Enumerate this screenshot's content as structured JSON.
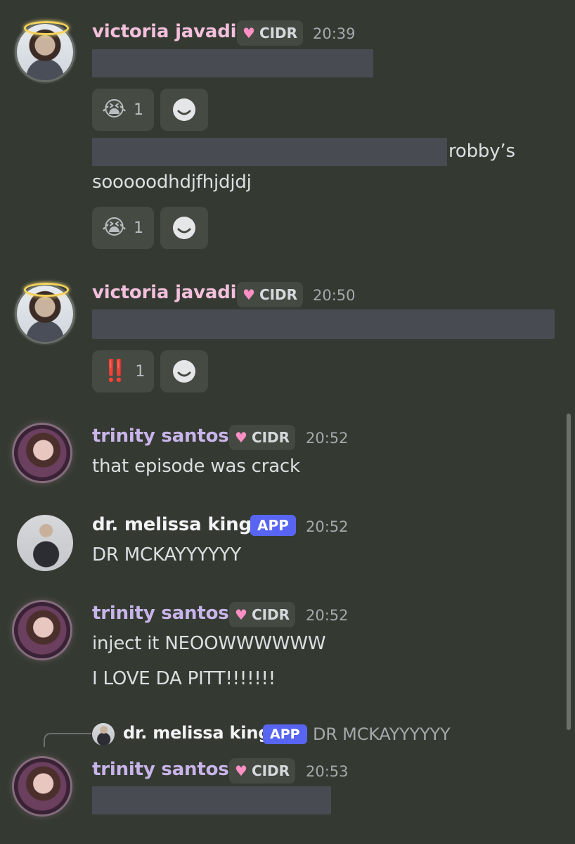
{
  "messages": {
    "g1": {
      "author": "victoria javadi",
      "tag": "CIDR",
      "time": "20:39",
      "reaction1": {
        "emoji": "😭",
        "count": "1"
      },
      "text_after_redact": "robby’s",
      "text_line2": "sooooodhdjfhjdjdj",
      "reaction2": {
        "emoji": "😭",
        "count": "1"
      }
    },
    "g2": {
      "author": "victoria javadi",
      "tag": "CIDR",
      "time": "20:50",
      "reaction": {
        "emoji": "‼️",
        "count": "1"
      }
    },
    "g3": {
      "author": "trinity santos",
      "tag": "CIDR",
      "time": "20:52",
      "text": "that episode was crack"
    },
    "g4": {
      "author": "dr. melissa king",
      "badge": "APP",
      "time": "20:52",
      "text": "DR MCKAYYYYYY"
    },
    "g5": {
      "author": "trinity santos",
      "tag": "CIDR",
      "time": "20:52",
      "line1": "inject it NEOOWWWWWW",
      "line2": "I LOVE DA PITT!!!!!!!"
    },
    "g6": {
      "reply": {
        "author": "dr. melissa king",
        "badge": "APP",
        "text": "DR MCKAYYYYYY"
      },
      "author": "trinity santos",
      "tag": "CIDR",
      "time": "20:53"
    }
  },
  "icons": {
    "heart": "♥",
    "add_reaction": "smile-plus-icon"
  },
  "colors": {
    "background": "#343a32",
    "app_badge": "#5865f2",
    "name_victoria": "#f3bfdc",
    "name_trinity": "#c9b4ea"
  }
}
